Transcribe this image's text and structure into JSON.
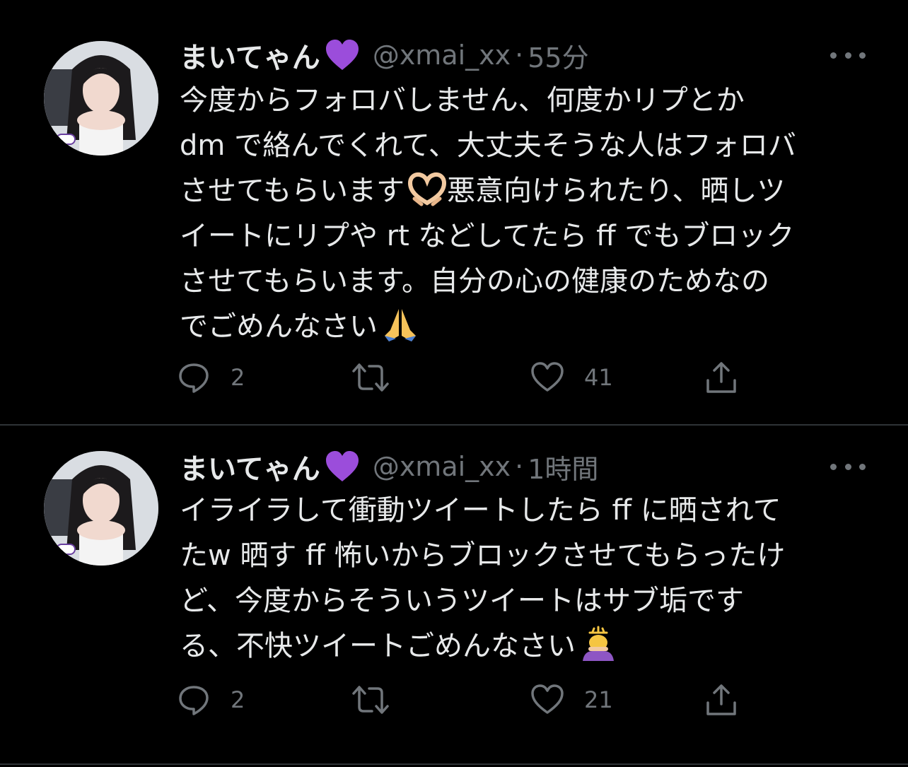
{
  "colors": {
    "background": "#000000",
    "text": "#e7e9ea",
    "muted": "#71767b",
    "divider": "#2f3336",
    "heart_emoji": "#9b4ddb"
  },
  "tweets": [
    {
      "display_name": "まいてゃん",
      "name_emoji": "purple-heart",
      "handle": "@xmai_xx",
      "separator": "·",
      "time": "55分",
      "lines": [
        "今度からフォロバしません、何度かリプとか",
        "dm で絡んでくれて、大丈夫そうな人はフォロバ",
        "させてもらいます",
        "イートにリプや rt などしてたら ff でもブロック",
        "させてもらいます。自分の心の健康のためなの",
        "でごめんなさい"
      ],
      "line3_tail": "悪意向けられたり、晒しツ",
      "emojis": [
        "heart-hands",
        "folded-hands"
      ],
      "reply_count": "2",
      "retweet_count": "",
      "like_count": "41"
    },
    {
      "display_name": "まいてゃん",
      "name_emoji": "purple-heart",
      "handle": "@xmai_xx",
      "separator": "·",
      "time": "1時間",
      "lines": [
        "イライラして衝動ツイートしたら ff に晒されて",
        "たw 晒す ff 怖いからブロックさせてもらったけ",
        "ど、今度からそういうツイートはサブ垢です",
        "る、不快ツイートごめんなさい"
      ],
      "emojis": [
        "person-bowing"
      ],
      "reply_count": "2",
      "retweet_count": "",
      "like_count": "21"
    }
  ]
}
